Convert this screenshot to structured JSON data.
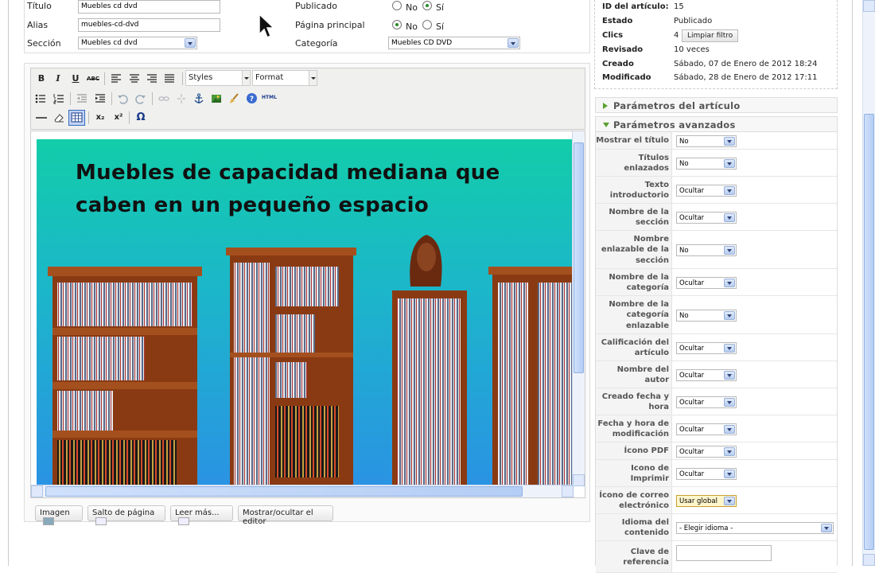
{
  "form": {
    "titulo_label": "Título",
    "titulo_value": "Muebles cd dvd",
    "alias_label": "Alias",
    "alias_value": "muebles-cd-dvd",
    "seccion_label": "Sección",
    "seccion_value": "Muebles cd dvd",
    "publicado_label": "Publicado",
    "pagina_principal_label": "Página principal",
    "categoria_label": "Categoría",
    "categoria_value": "Muebles CD DVD",
    "no_label": "No",
    "si_label": "Sí",
    "publicado_selected": "Sí",
    "pagina_principal_selected": "No"
  },
  "toolbar": {
    "bold": "B",
    "italic": "I",
    "underline": "U",
    "strikethrough": "ABC",
    "styles_label": "Styles",
    "format_label": "Format",
    "html_label": "HTML",
    "subscript": "x₂",
    "superscript": "x²",
    "omega": "Ω"
  },
  "content": {
    "headline_line1": "Muebles de capacidad mediana que",
    "headline_line2": "caben en un pequeño espacio"
  },
  "editor_buttons": {
    "imagen": "Imagen",
    "salto": "Salto de página",
    "leer_mas": "Leer más...",
    "toggle": "Mostrar/ocultar el editor"
  },
  "info": {
    "id_label": "ID del artículo:",
    "id_value": "15",
    "estado_label": "Estado",
    "estado_value": "Publicado",
    "clics_label": "Clics",
    "clics_value": "4",
    "limpiar_label": "Limpiar filtro",
    "revisado_label": "Revisado",
    "revisado_value": "10 veces",
    "creado_label": "Creado",
    "creado_value": "Sábado, 07 de Enero de 2012 18:24",
    "modificado_label": "Modificado",
    "modificado_value": "Sábado, 28 de Enero de 2012 17:11"
  },
  "panels": {
    "articulo": "Parámetros del artículo",
    "avanzados": "Parámetros avanzados"
  },
  "params": [
    {
      "label": "Mostrar el título",
      "value": "No"
    },
    {
      "label": "Títulos enlazados",
      "value": "No"
    },
    {
      "label": "Texto introductorio",
      "value": "Ocultar"
    },
    {
      "label": "Nombre de la sección",
      "value": "Ocultar"
    },
    {
      "label": "Nombre enlazable de la sección",
      "value": "No"
    },
    {
      "label": "Nombre de la categoría",
      "value": "Ocultar"
    },
    {
      "label": "Nombre de la categoría enlazable",
      "value": "No"
    },
    {
      "label": "Calificación del artículo",
      "value": "Ocultar"
    },
    {
      "label": "Nombre del autor",
      "value": "Ocultar"
    },
    {
      "label": "Creado fecha y hora",
      "value": "Ocultar"
    },
    {
      "label": "Fecha y hora de modificación",
      "value": "Ocultar"
    },
    {
      "label": "Ícono PDF",
      "value": "Ocultar"
    },
    {
      "label": "Icono de Imprimir",
      "value": "Ocultar"
    },
    {
      "label": "Ícono de correo electrónico",
      "value": "Usar global"
    },
    {
      "label": "Idioma del contenido",
      "value": "- Elegir idioma -"
    },
    {
      "label": "Clave de referencia",
      "value": ""
    }
  ],
  "colors": {
    "panel_triangle": "#5aa02c",
    "image_top": "#12cda9",
    "image_bottom": "#2a93e4",
    "highlight_select": "#fff6cc"
  }
}
